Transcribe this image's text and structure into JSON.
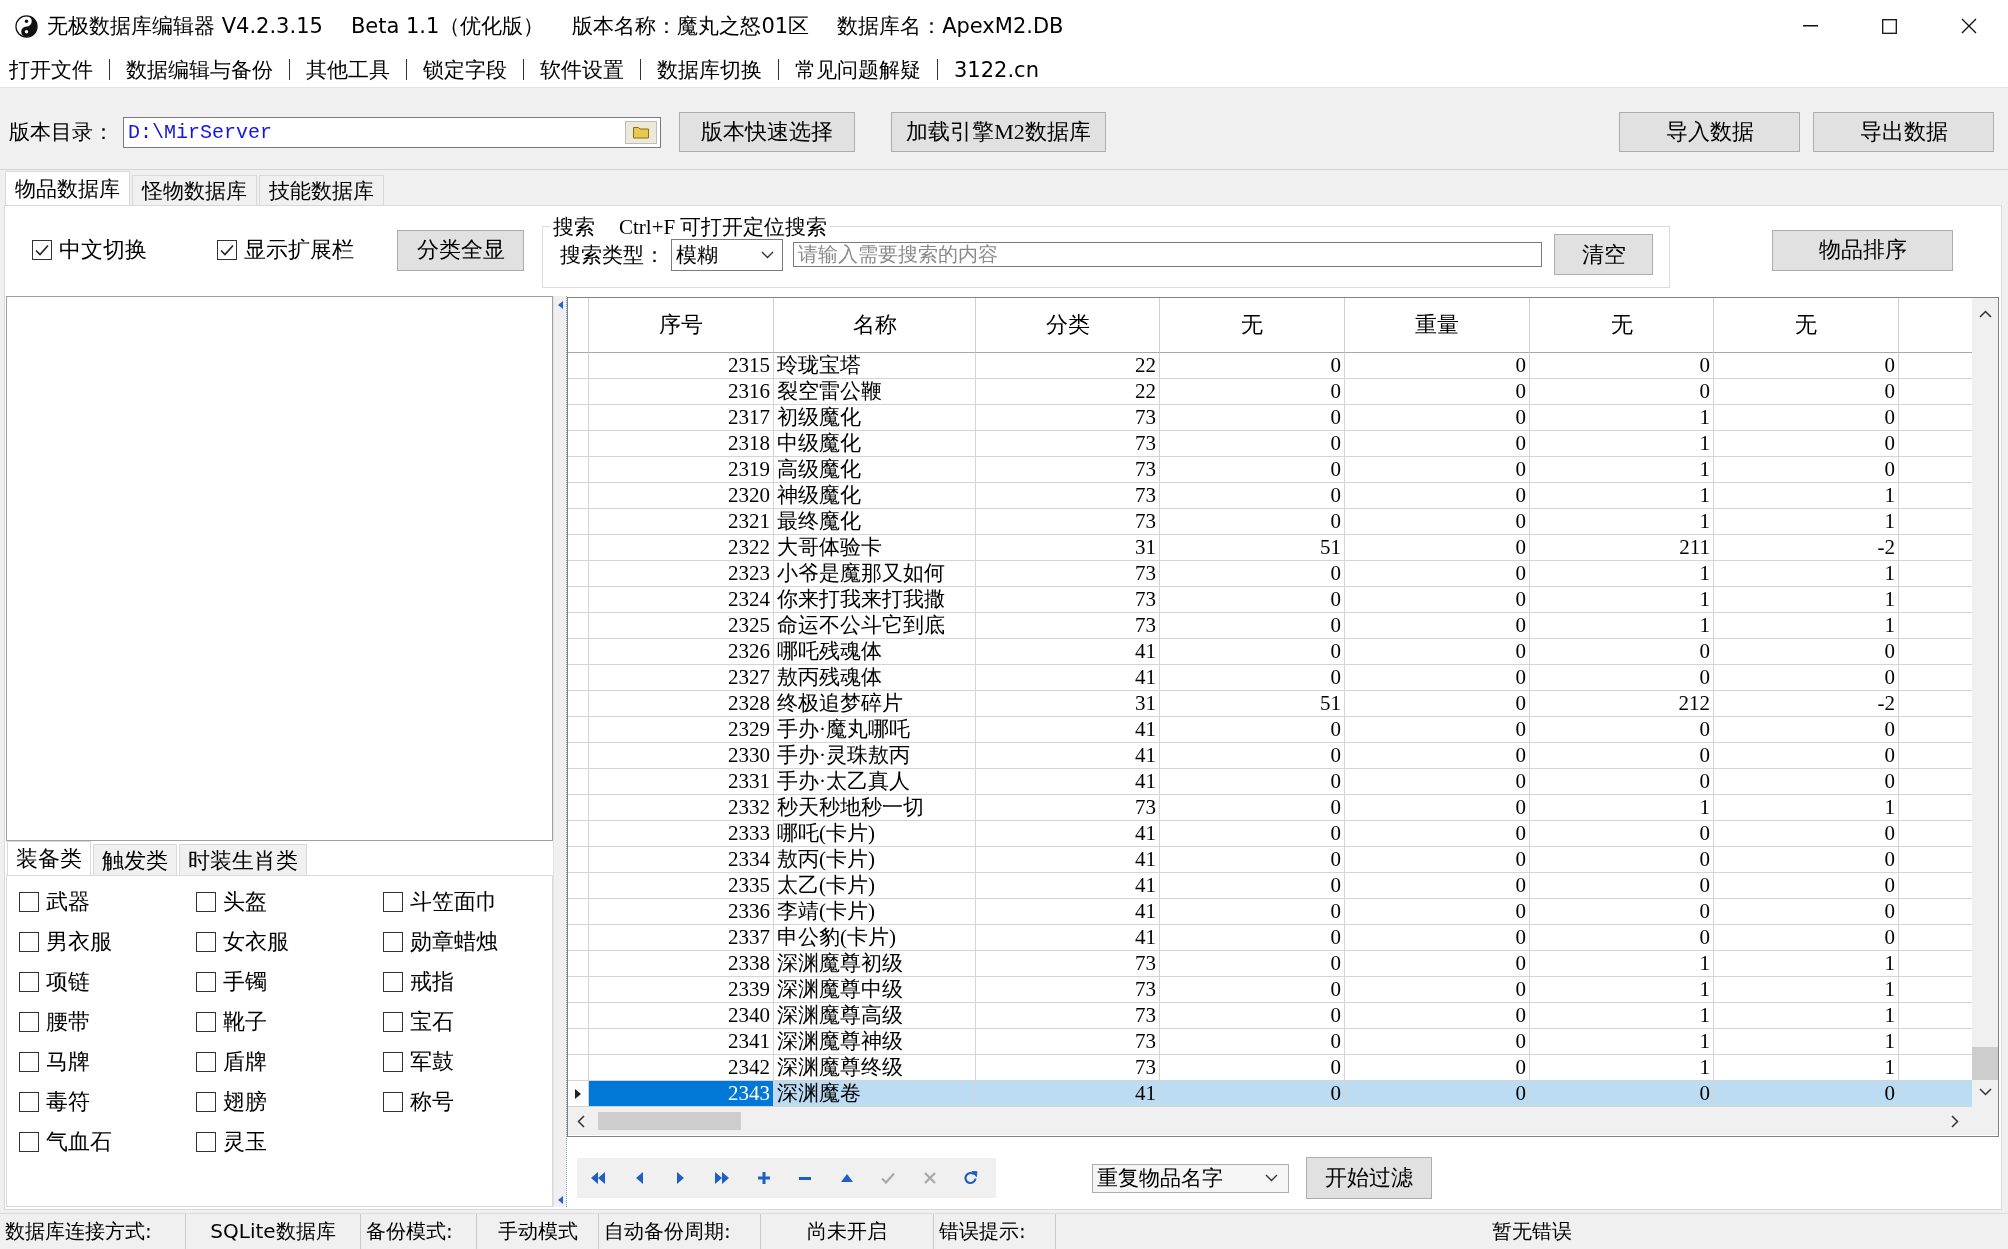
{
  "window": {
    "title": "无极数据库编辑器 V4.2.3.15",
    "edition": "Beta 1.1（优化版）",
    "version_name": "版本名称：魔丸之怒01区",
    "database_name": "数据库名：ApexM2.DB"
  },
  "menu": [
    "打开文件",
    "数据编辑与备份",
    "其他工具",
    "锁定字段",
    "软件设置",
    "数据库切换",
    "常见问题解疑",
    "3122.cn"
  ],
  "toolbar": {
    "directory_label": "版本目录：",
    "directory": "D:\\MirServer",
    "buttons": [
      "版本快速选择",
      "加载引擎M2数据库"
    ],
    "data_buttons": [
      "导入数据",
      "导出数据"
    ]
  },
  "tabs": [
    {
      "label": "物品数据库",
      "selected": true
    },
    {
      "label": "怪物数据库",
      "selected": false
    },
    {
      "label": "技能数据库",
      "selected": false
    }
  ],
  "options": {
    "toggles": [
      {
        "label": "中文切换",
        "checked": true
      },
      {
        "label": "显示扩展栏",
        "checked": true
      }
    ],
    "show_all_button": "分类全显"
  },
  "search": {
    "title": "搜索",
    "hint": "Ctrl+F 可打开定位搜索",
    "type_label": "搜索类型：",
    "type_value": "模糊",
    "placeholder": "请输入需要搜索的内容",
    "clear_button": "清空"
  },
  "sort_button": "物品排序",
  "category_tabs": [
    {
      "label": "装备类",
      "selected": true
    },
    {
      "label": "触发类",
      "selected": false
    },
    {
      "label": "时装生肖类",
      "selected": false
    }
  ],
  "categories": [
    {
      "label": "武器",
      "checked": false
    },
    {
      "label": "头盔",
      "checked": false
    },
    {
      "label": "斗笠面巾",
      "checked": false
    },
    {
      "label": "男衣服",
      "checked": false
    },
    {
      "label": "女衣服",
      "checked": false
    },
    {
      "label": "勋章蜡烛",
      "checked": false
    },
    {
      "label": "项链",
      "checked": false
    },
    {
      "label": "手镯",
      "checked": false
    },
    {
      "label": "戒指",
      "checked": false
    },
    {
      "label": "腰带",
      "checked": false
    },
    {
      "label": "靴子",
      "checked": false
    },
    {
      "label": "宝石",
      "checked": false
    },
    {
      "label": "马牌",
      "checked": false
    },
    {
      "label": "盾牌",
      "checked": false
    },
    {
      "label": "军鼓",
      "checked": false
    },
    {
      "label": "毒符",
      "checked": false
    },
    {
      "label": "翅膀",
      "checked": false
    },
    {
      "label": "称号",
      "checked": false
    },
    {
      "label": "气血石",
      "checked": false
    },
    {
      "label": "灵玉",
      "checked": false
    }
  ],
  "table": {
    "columns": [
      "序号",
      "名称",
      "分类",
      "无",
      "重量",
      "无",
      "无"
    ],
    "rows": [
      {
        "cells": [
          "2315",
          "玲珑宝塔",
          "22",
          "0",
          "0",
          "0",
          "0"
        ],
        "selected": false
      },
      {
        "cells": [
          "2316",
          "裂空雷公鞭",
          "22",
          "0",
          "0",
          "0",
          "0"
        ],
        "selected": false
      },
      {
        "cells": [
          "2317",
          "初级魔化",
          "73",
          "0",
          "0",
          "1",
          "0"
        ],
        "selected": false
      },
      {
        "cells": [
          "2318",
          "中级魔化",
          "73",
          "0",
          "0",
          "1",
          "0"
        ],
        "selected": false
      },
      {
        "cells": [
          "2319",
          "高级魔化",
          "73",
          "0",
          "0",
          "1",
          "0"
        ],
        "selected": false
      },
      {
        "cells": [
          "2320",
          "神级魔化",
          "73",
          "0",
          "0",
          "1",
          "1"
        ],
        "selected": false
      },
      {
        "cells": [
          "2321",
          "最终魔化",
          "73",
          "0",
          "0",
          "1",
          "1"
        ],
        "selected": false
      },
      {
        "cells": [
          "2322",
          "大哥体验卡",
          "31",
          "51",
          "0",
          "211",
          "-2"
        ],
        "selected": false
      },
      {
        "cells": [
          "2323",
          "小爷是魔那又如何",
          "73",
          "0",
          "0",
          "1",
          "1"
        ],
        "selected": false
      },
      {
        "cells": [
          "2324",
          "你来打我来打我撒",
          "73",
          "0",
          "0",
          "1",
          "1"
        ],
        "selected": false
      },
      {
        "cells": [
          "2325",
          "命运不公斗它到底",
          "73",
          "0",
          "0",
          "1",
          "1"
        ],
        "selected": false
      },
      {
        "cells": [
          "2326",
          "哪吒残魂体",
          "41",
          "0",
          "0",
          "0",
          "0"
        ],
        "selected": false
      },
      {
        "cells": [
          "2327",
          "敖丙残魂体",
          "41",
          "0",
          "0",
          "0",
          "0"
        ],
        "selected": false
      },
      {
        "cells": [
          "2328",
          "终极追梦碎片",
          "31",
          "51",
          "0",
          "212",
          "-2"
        ],
        "selected": false
      },
      {
        "cells": [
          "2329",
          "手办·魔丸哪吒",
          "41",
          "0",
          "0",
          "0",
          "0"
        ],
        "selected": false
      },
      {
        "cells": [
          "2330",
          "手办·灵珠敖丙",
          "41",
          "0",
          "0",
          "0",
          "0"
        ],
        "selected": false
      },
      {
        "cells": [
          "2331",
          "手办·太乙真人",
          "41",
          "0",
          "0",
          "0",
          "0"
        ],
        "selected": false
      },
      {
        "cells": [
          "2332",
          "秒天秒地秒一切",
          "73",
          "0",
          "0",
          "1",
          "1"
        ],
        "selected": false
      },
      {
        "cells": [
          "2333",
          "哪吒(卡片)",
          "41",
          "0",
          "0",
          "0",
          "0"
        ],
        "selected": false
      },
      {
        "cells": [
          "2334",
          "敖丙(卡片)",
          "41",
          "0",
          "0",
          "0",
          "0"
        ],
        "selected": false
      },
      {
        "cells": [
          "2335",
          "太乙(卡片)",
          "41",
          "0",
          "0",
          "0",
          "0"
        ],
        "selected": false
      },
      {
        "cells": [
          "2336",
          "李靖(卡片)",
          "41",
          "0",
          "0",
          "0",
          "0"
        ],
        "selected": false
      },
      {
        "cells": [
          "2337",
          "申公豹(卡片)",
          "41",
          "0",
          "0",
          "0",
          "0"
        ],
        "selected": false
      },
      {
        "cells": [
          "2338",
          "深渊魔尊初级",
          "73",
          "0",
          "0",
          "1",
          "1"
        ],
        "selected": false
      },
      {
        "cells": [
          "2339",
          "深渊魔尊中级",
          "73",
          "0",
          "0",
          "1",
          "1"
        ],
        "selected": false
      },
      {
        "cells": [
          "2340",
          "深渊魔尊高级",
          "73",
          "0",
          "0",
          "1",
          "1"
        ],
        "selected": false
      },
      {
        "cells": [
          "2341",
          "深渊魔尊神级",
          "73",
          "0",
          "0",
          "1",
          "1"
        ],
        "selected": false
      },
      {
        "cells": [
          "2342",
          "深渊魔尊终级",
          "73",
          "0",
          "0",
          "1",
          "1"
        ],
        "selected": false
      },
      {
        "cells": [
          "2343",
          "深渊魔卷",
          "41",
          "0",
          "0",
          "0",
          "0"
        ],
        "selected": true
      }
    ]
  },
  "navigator": [
    {
      "kind": "first",
      "disabled": false
    },
    {
      "kind": "prior",
      "disabled": false
    },
    {
      "kind": "next",
      "disabled": false
    },
    {
      "kind": "last",
      "disabled": false
    },
    {
      "kind": "insert",
      "disabled": false
    },
    {
      "kind": "delete",
      "disabled": false
    },
    {
      "kind": "edit",
      "disabled": false
    },
    {
      "kind": "post",
      "disabled": true
    },
    {
      "kind": "cancel",
      "disabled": true
    },
    {
      "kind": "refresh",
      "disabled": false
    }
  ],
  "filter": {
    "mode": "重复物品名字",
    "button": "开始过滤"
  },
  "status_bar": [
    "数据库连接方式:",
    "SQLite数据库",
    "备份模式:",
    "手动模式",
    "自动备份周期:",
    "尚未开启",
    "错误提示:",
    "暂无错误"
  ]
}
